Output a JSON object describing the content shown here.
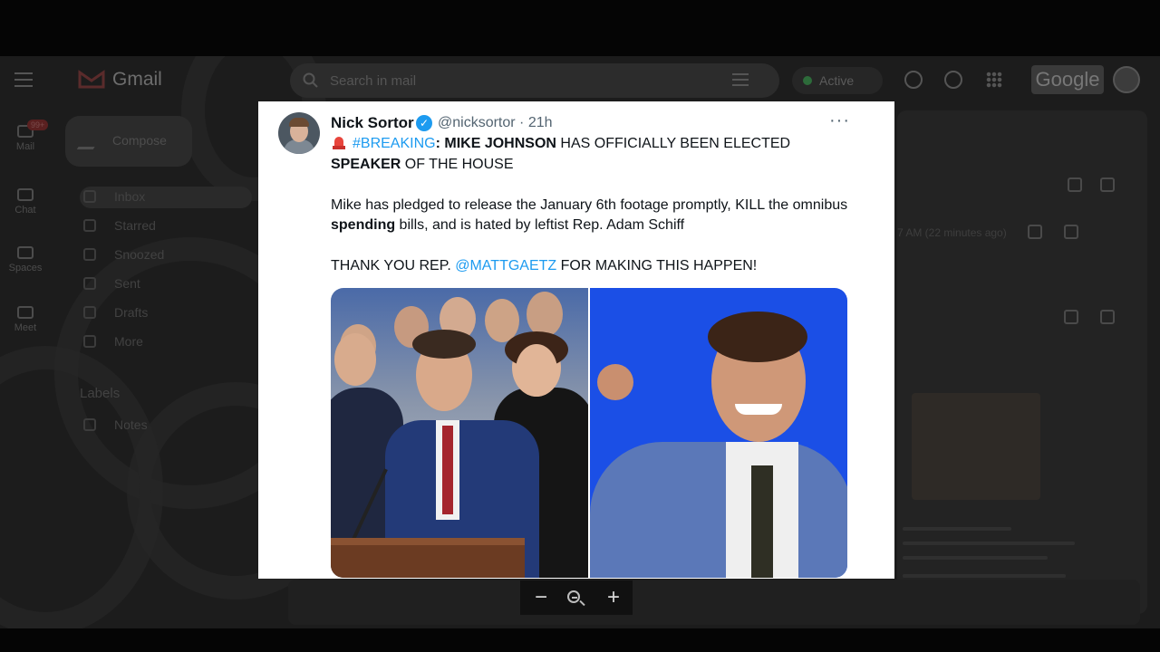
{
  "gmail": {
    "app_name": "Gmail",
    "search_placeholder": "Search in mail",
    "status": "Active",
    "google_label": "Google",
    "compose_label": "Compose",
    "mail_badge": "99+",
    "rail": [
      "Mail",
      "Chat",
      "Spaces",
      "Meet"
    ],
    "nav": [
      "Inbox",
      "Starred",
      "Snoozed",
      "Sent",
      "Drafts",
      "More"
    ],
    "labels_heading": "Labels",
    "label_items": [
      "Notes"
    ],
    "reading_time": "7 AM (22 minutes ago)"
  },
  "tweet": {
    "author": "Nick Sortor",
    "handle_time": "@nicksortor · 21h",
    "more_glyph": "···",
    "line1": {
      "hashtag": "#BREAKING",
      "colon": ": ",
      "name": "MIKE JOHNSON",
      "rest": " HAS OFFICIALLY BEEN ELECTED"
    },
    "line2": {
      "speaker": "SPEAKER",
      "rest": " OF THE HOUSE"
    },
    "para2": {
      "a": "Mike has pledged to release the January 6th footage promptly, KILL the omnibus ",
      "spending": "spending",
      "b": " bills, and is hated by leftist Rep. Adam Schiff"
    },
    "para3": {
      "a": "THANK YOU REP. ",
      "mention": "@MATTGAETZ",
      "b": " FOR MAKING THIS HAPPEN!"
    }
  },
  "zoom": {
    "minus": "−",
    "plus": "+"
  },
  "colors": {
    "link": "#1d9bf0",
    "verified": "#1d9bf0",
    "right_photo_bg": "#1b4fe6"
  }
}
